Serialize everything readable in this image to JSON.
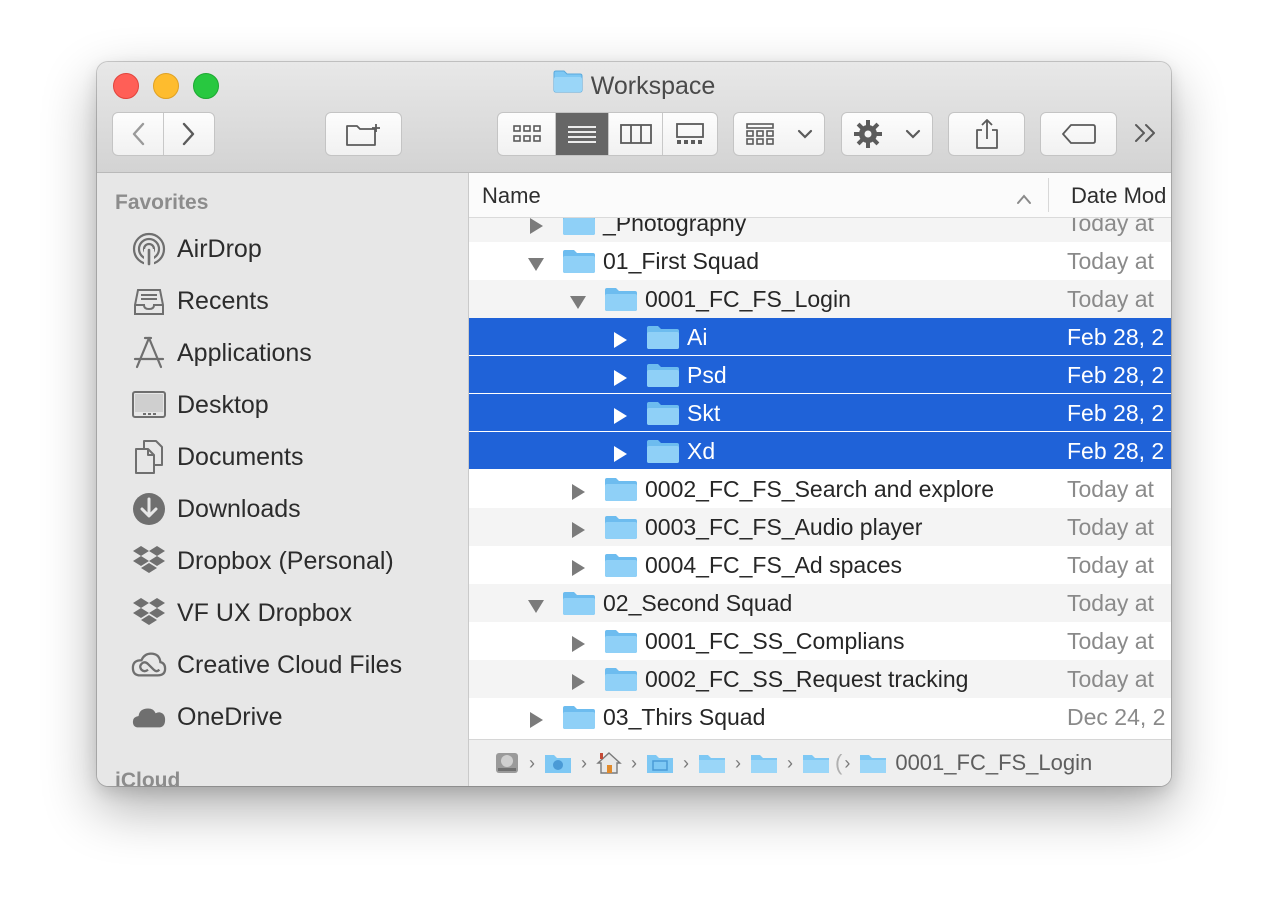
{
  "window": {
    "title": "Workspace"
  },
  "sidebar": {
    "favorites_label": "Favorites",
    "items": [
      {
        "label": "AirDrop",
        "icon": "airdrop-icon"
      },
      {
        "label": "Recents",
        "icon": "recents-icon"
      },
      {
        "label": "Applications",
        "icon": "applications-icon"
      },
      {
        "label": "Desktop",
        "icon": "desktop-icon"
      },
      {
        "label": "Documents",
        "icon": "documents-icon"
      },
      {
        "label": "Downloads",
        "icon": "downloads-icon"
      },
      {
        "label": "Dropbox (Personal)",
        "icon": "dropbox-icon"
      },
      {
        "label": "VF UX Dropbox",
        "icon": "dropbox-icon"
      },
      {
        "label": "Creative Cloud Files",
        "icon": "creative-cloud-icon"
      },
      {
        "label": "OneDrive",
        "icon": "onedrive-icon"
      }
    ],
    "icloud_label": "iCloud"
  },
  "columns": {
    "name": "Name",
    "date": "Date Mod"
  },
  "rows": [
    {
      "name": "_Photography",
      "date": "Today at",
      "expanded": false,
      "selected": false
    },
    {
      "name": "01_First Squad",
      "date": "Today at",
      "expanded": true,
      "selected": false
    },
    {
      "name": "0001_FC_FS_Login",
      "date": "Today at",
      "expanded": true,
      "selected": false
    },
    {
      "name": "Ai",
      "date": "Feb 28, 2",
      "expanded": false,
      "selected": true
    },
    {
      "name": "Psd",
      "date": "Feb 28, 2",
      "expanded": false,
      "selected": true
    },
    {
      "name": "Skt",
      "date": "Feb 28, 2",
      "expanded": false,
      "selected": true
    },
    {
      "name": "Xd",
      "date": "Feb 28, 2",
      "expanded": false,
      "selected": true
    },
    {
      "name": "0002_FC_FS_Search and explore",
      "date": "Today at",
      "expanded": false,
      "selected": false
    },
    {
      "name": "0003_FC_FS_Audio player",
      "date": "Today at",
      "expanded": false,
      "selected": false
    },
    {
      "name": "0004_FC_FS_Ad spaces",
      "date": "Today at",
      "expanded": false,
      "selected": false
    },
    {
      "name": "02_Second Squad",
      "date": "Today at",
      "expanded": true,
      "selected": false
    },
    {
      "name": "0001_FC_SS_Complians",
      "date": "Today at",
      "expanded": false,
      "selected": false
    },
    {
      "name": "0002_FC_SS_Request tracking",
      "date": "Today at",
      "expanded": false,
      "selected": false
    },
    {
      "name": "03_Thirs Squad",
      "date": "Dec 24, 2",
      "expanded": false,
      "selected": false
    }
  ],
  "pathbar": {
    "partial": "(",
    "current": "0001_FC_FS_Login"
  },
  "colors": {
    "selection": "#1f62d8",
    "folder": "#7ec8f4",
    "accent_gray": "#666666"
  }
}
